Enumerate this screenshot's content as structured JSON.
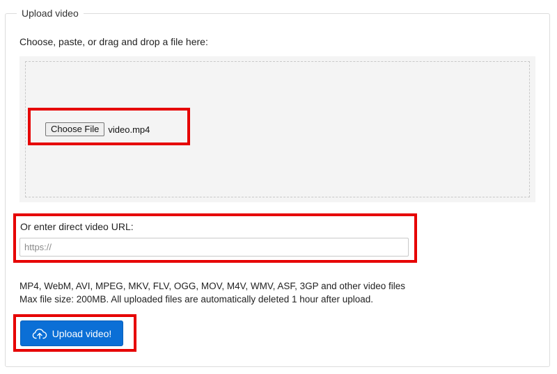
{
  "panel": {
    "legend": "Upload video",
    "instruction": "Choose, paste, or drag and drop a file here:"
  },
  "file_input": {
    "button_label": "Choose File",
    "file_name": "video.mp4"
  },
  "url_input": {
    "label": "Or enter direct video URL:",
    "placeholder": "https://",
    "value": ""
  },
  "info": {
    "formats": "MP4, WebM, AVI, MPEG, MKV, FLV, OGG, MOV, M4V, WMV, ASF, 3GP and other video files",
    "limits": "Max file size: 200MB. All uploaded files are automatically deleted 1 hour after upload."
  },
  "upload_button": {
    "label": "Upload video!",
    "icon": "cloud-upload-icon",
    "color": "#0b6fd6"
  },
  "annotations": {
    "highlight_color": "#e60000"
  }
}
